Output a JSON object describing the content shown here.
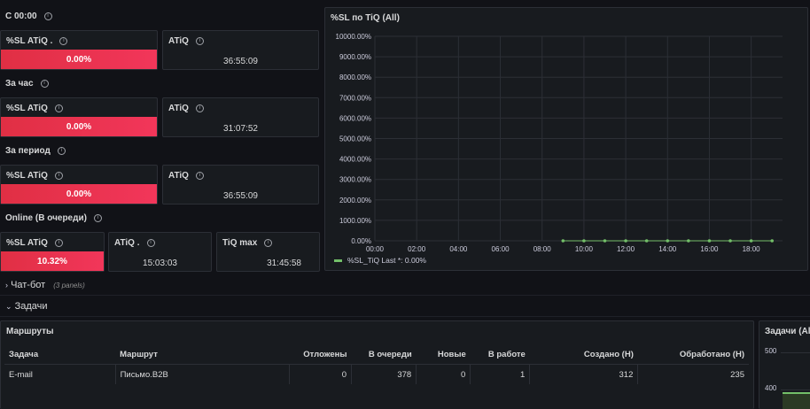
{
  "rows": [
    {
      "title": "С 00:00",
      "sl_label": "%SL ATiQ .",
      "sl_value": "0.00%",
      "atiq_label": "ATiQ",
      "atiq_value": "36:55:09"
    },
    {
      "title": "За час",
      "sl_label": "%SL ATiQ",
      "sl_value": "0.00%",
      "atiq_label": "ATiQ",
      "atiq_value": "31:07:52"
    },
    {
      "title": "За период",
      "sl_label": "%SL ATiQ",
      "sl_value": "0.00%",
      "atiq_label": "ATiQ",
      "atiq_value": "36:55:09"
    }
  ],
  "online": {
    "title": "Online (В очереди)",
    "sl_label": "%SL ATiQ",
    "sl_value": "10.32%",
    "atiq_label": "ATiQ .",
    "atiq_value": "15:03:03",
    "tiq_label": "TiQ max",
    "tiq_value": "31:45:58"
  },
  "chart_panel": {
    "title": "%SL по TiQ (All)",
    "legend_text": "%SL_TiQ  Last *: 0.00%"
  },
  "chart_data": {
    "type": "line",
    "title": "%SL по TiQ (All)",
    "ylim": [
      0,
      10000
    ],
    "yticks": [
      "0.00%",
      "1000.00%",
      "2000.00%",
      "3000.00%",
      "4000.00%",
      "5000.00%",
      "6000.00%",
      "7000.00%",
      "8000.00%",
      "9000.00%",
      "10000.00%"
    ],
    "xticks": [
      "00:00",
      "02:00",
      "04:00",
      "06:00",
      "08:00",
      "10:00",
      "12:00",
      "14:00",
      "16:00",
      "18:00"
    ],
    "series": [
      {
        "name": "%SL_TiQ",
        "color": "#73bf69",
        "x": [
          "09:00",
          "10:00",
          "11:00",
          "12:00",
          "13:00",
          "14:00",
          "15:00",
          "16:00",
          "17:00",
          "18:00",
          "19:00"
        ],
        "values": [
          0,
          0,
          0,
          0,
          0,
          0,
          0,
          0,
          0,
          0,
          0
        ]
      }
    ],
    "grid": true,
    "legend_position": "bottom-left"
  },
  "sections": {
    "chatbot": {
      "label": "Чат-бот",
      "count": "(3 panels)"
    },
    "tasks": {
      "label": "Задачи"
    }
  },
  "routes_panel": {
    "title": "Маршруты",
    "columns": [
      "Задача",
      "Маршрут",
      "Отложены",
      "В очереди",
      "Новые",
      "В работе",
      "Создано (Н)",
      "Обработано (Н)"
    ],
    "rows": [
      [
        "E-mail",
        "Письмо.B2B",
        "0",
        "378",
        "0",
        "1",
        "312",
        "235"
      ]
    ]
  },
  "tasks_panel": {
    "title": "Задачи (All)",
    "yticks": [
      "500",
      "400"
    ]
  },
  "colors": {
    "red": "#e02f44",
    "green": "#73bf69",
    "panel_bg": "#181b1f",
    "page_bg": "#111217"
  }
}
